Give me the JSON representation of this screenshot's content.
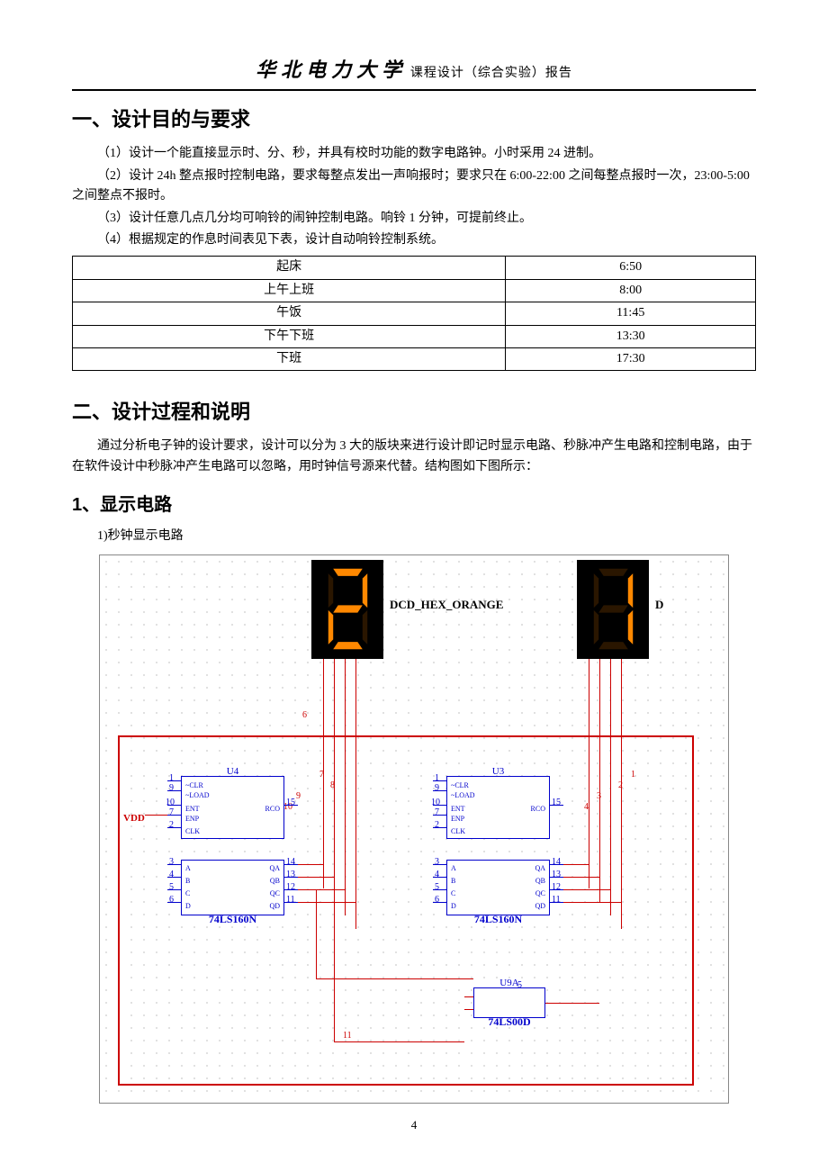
{
  "header": {
    "university": "华北电力大学",
    "subtitle": "课程设计（综合实验）报告"
  },
  "section1": {
    "title": "一、设计目的与要求",
    "p1": "（1）设计一个能直接显示时、分、秒，并具有校时功能的数字电路钟。小时采用 24 进制。",
    "p2": "（2）设计 24h 整点报时控制电路，要求每整点发出一声响报时；要求只在 6:00-22:00 之间每整点报时一次，23:00-5:00 之间整点不报时。",
    "p3": "（3）设计任意几点几分均可响铃的闹钟控制电路。响铃 1 分钟，可提前终止。",
    "p4": "（4）根据规定的作息时间表见下表，设计自动响铃控制系统。",
    "table": [
      {
        "event": "起床",
        "time": "6:50"
      },
      {
        "event": "上午上班",
        "time": "8:00"
      },
      {
        "event": "午饭",
        "time": "11:45"
      },
      {
        "event": "下午下班",
        "time": "13:30"
      },
      {
        "event": "下班",
        "time": "17:30"
      }
    ]
  },
  "section2": {
    "title": "二、设计过程和说明",
    "intro": "通过分析电子钟的设计要求，设计可以分为 3 大的版块来进行设计即记时显示电路、秒脉冲产生电路和控制电路，由于在软件设计中秒脉冲产生电路可以忽略，用时钟信号源来代替。结构图如下图所示：",
    "sub1": {
      "title": "1、显示电路",
      "p1": "1)秒钟显示电路"
    }
  },
  "circuit": {
    "display_label": "DCD_HEX_ORANGE",
    "chip_left": {
      "title": "U4",
      "name": "74LS160N"
    },
    "chip_right": {
      "title": "U3",
      "name": "74LS160N"
    },
    "gate": {
      "title": "U9A",
      "name": "74LS00D"
    },
    "vdd": "VDD",
    "pins_top": {
      "clr": "~CLR",
      "load": "~LOAD",
      "ent": "ENT",
      "enp": "ENP",
      "clk": "CLK",
      "rco": "RCO"
    },
    "pins_bot": {
      "a": "A",
      "b": "B",
      "c": "C",
      "d": "D",
      "qa": "QA",
      "qb": "QB",
      "qc": "QC",
      "qd": "QD"
    },
    "pin_nums_l": [
      "1",
      "9",
      "10",
      "7",
      "2"
    ],
    "pin_nums_r": [
      "15"
    ],
    "pin_nums_bot_l": [
      "3",
      "4",
      "5",
      "6"
    ],
    "pin_nums_bot_r": [
      "14",
      "13",
      "12",
      "11"
    ],
    "red_labels": {
      "six": "6",
      "seven": "7",
      "eight": "8",
      "nine": "9",
      "ten": "10",
      "one": "1",
      "two": "2",
      "three": "3",
      "four": "4",
      "eleven": "11",
      "gate5": "5"
    }
  },
  "page_number": "4"
}
